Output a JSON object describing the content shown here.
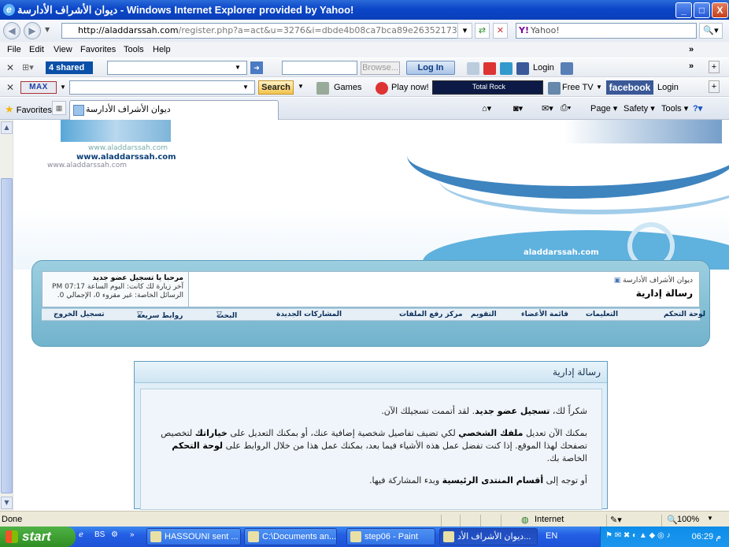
{
  "window": {
    "title": "ديوان الأشراف الأدارسة - Windows Internet Explorer provided by Yahoo!",
    "minimize": "_",
    "maximize": "□",
    "close": "X"
  },
  "address": {
    "url_host": "http://aladdarssah.com",
    "url_path": "/register.php?a=act&u=3276&i=dbde4b08ca7bca89e26352173582b445538d0abb",
    "search_placeholder": "Yahoo!"
  },
  "menu": [
    "File",
    "Edit",
    "View",
    "Favorites",
    "Tools",
    "Help"
  ],
  "toolbar1": {
    "brand": "4 shared",
    "browse": "Browse...",
    "login_button": "Log In",
    "login_text": "Login"
  },
  "toolbar2": {
    "max": "MAX",
    "search_button": "Search",
    "games": "Games",
    "play": "Play now!",
    "total_rock": "Total Rock",
    "free_tv": "Free TV",
    "facebook": "facebook",
    "login": "Login"
  },
  "tabs": {
    "favorites": "Favorites",
    "active_tab": "ديوان الأشراف الأدارسة",
    "page": "Page",
    "safety": "Safety",
    "tools": "Tools"
  },
  "banner": {
    "site1": "www.aladdarssah.com",
    "site2": "www.aladdarssah.com",
    "site3": "www.aladdarssah.com",
    "site_right": "aladdarssah.com"
  },
  "forum": {
    "welcome_line": "مرحبا يا تسجيل عضو جديد",
    "last_visit": "آخر زيارة لك كانت: اليوم الساعة 07:17 PM",
    "private_messages": "الرسائل الخاصة: غير مقروء 0، الإجمالي 0.",
    "breadcrumb": "ديوان الأشراف الأدارسة",
    "page_title": "رسالة إدارية",
    "nav": [
      "لوحة التحكم",
      "التعليمات",
      "قائمة الأعضاء",
      "التقويم",
      "مركز رفع الملفات",
      "المشاركات الجديدة",
      "البحث",
      "روابط سريعة",
      "تسجيل الخروج"
    ]
  },
  "message": {
    "header": "رسالة إدارية",
    "p1_a": "شكراً لك،",
    "p1_b": "تسجيل عضو جديد",
    "p1_c": ". لقد أتممت تسجيلك الآن.",
    "p2_a": "بمكنك الآن تعديل",
    "p2_b": "ملفك الشخصي",
    "p2_c": "لكي تضيف تفاصيل شخصية إضافية عنك، أو بمكنك التعديل على",
    "p2_d": "خياراتك",
    "p2_e": "لتخصيص تصفحك لهذا الموقع. إذا كنت تفضل عمل هذه الأشياء فيما بعد، بمكنك عمل هذا من خلال الروابط على",
    "p2_f": "لوحة التحكم",
    "p2_g": "الخاصة بك.",
    "p3_a": "أو توجه إلى",
    "p3_b": "أقسام المنتدى الرئيسية",
    "p3_c": "وبدء المشاركة فيها."
  },
  "status": {
    "left": "Done",
    "zone": "Internet",
    "zoom": "100%"
  },
  "taskbar": {
    "start": "start",
    "tasks": [
      "HASSOUNI sent ...",
      "C:\\Documents an...",
      "step06 - Paint",
      "ديوان الأشراف الأد..."
    ],
    "lang": "EN",
    "clock": "06:29 م"
  }
}
